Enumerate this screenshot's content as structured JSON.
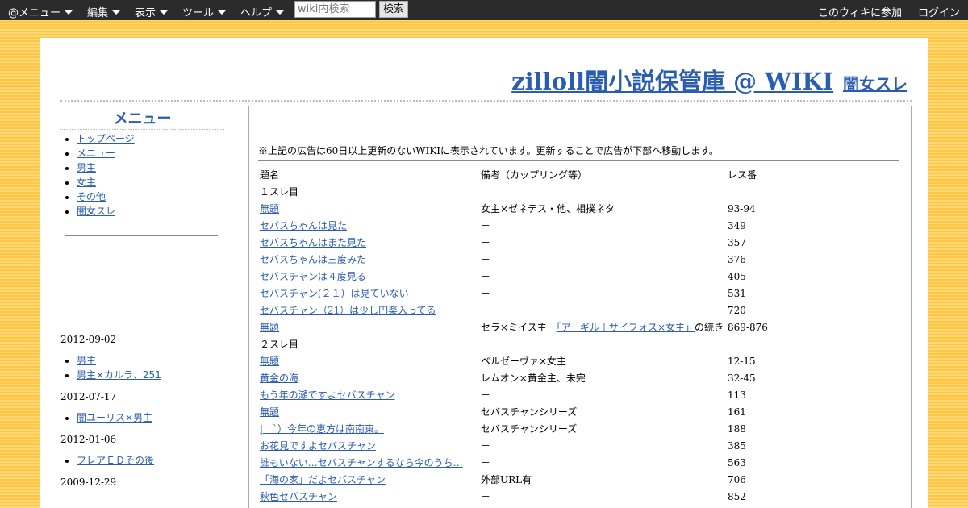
{
  "topbar": {
    "menus": [
      "@メニュー",
      "編集",
      "表示",
      "ツール",
      "ヘルプ"
    ],
    "search_placeholder": "wiki内検索",
    "search_button": "検索",
    "join_link": "このウィキに参加",
    "login_link": "ログイン"
  },
  "site": {
    "title": "zilloll闇小説保管庫 @ WIKI",
    "page_name": "闇女スレ"
  },
  "sidebar": {
    "heading": "メニュー",
    "items": [
      "トップページ",
      "メニュー",
      "男主",
      "女主",
      "その他",
      "闇女スレ"
    ]
  },
  "recent": [
    {
      "date": "2012-09-02",
      "items": [
        "男主",
        "男主×カルラ、251"
      ]
    },
    {
      "date": "2012-07-17",
      "items": [
        "闇ユーリス×男主"
      ]
    },
    {
      "date": "2012-01-06",
      "items": [
        "フレアＥＤその後"
      ]
    },
    {
      "date": "2009-12-29",
      "items": []
    }
  ],
  "main": {
    "notice": "※上記の広告は60日以上更新のないWIKIに表示されています。更新することで広告が下部へ移動します。",
    "headers": [
      "題名",
      "備考（カップリング等）",
      "レス番"
    ],
    "rows": [
      {
        "section": "１スレ目"
      },
      {
        "title": "無題",
        "note": "女主×ゼネテス・他、相撲ネタ",
        "res": "93-94"
      },
      {
        "title": "セバスちゃんは見た",
        "note": "－",
        "res": "349"
      },
      {
        "title": "セバスちゃんはまた見た",
        "note": "－",
        "res": "357"
      },
      {
        "title": "セバスちゃんは三度みた",
        "note": "－",
        "res": "376"
      },
      {
        "title": "セバスチャンは４度見る",
        "note": "－",
        "res": "405"
      },
      {
        "title": "セバスチャン(２１）は見ていない",
        "note": "－",
        "res": "531"
      },
      {
        "title": "セバスチャン（21）は少し円楽入ってる",
        "note": "－",
        "res": "720"
      },
      {
        "title": "無題",
        "note": "セラ×ミイス主　",
        "note_link": "「アーギル＋サイフォス×女主」",
        "note_tail": "の続き",
        "res": "869-876"
      },
      {
        "section": "２スレ目"
      },
      {
        "title": "無題",
        "note": "ベルゼーヴァ×女主",
        "res": "12-15"
      },
      {
        "title": "黄金の海",
        "note": "レムオン×黄金主、未完",
        "res": "32-45"
      },
      {
        "title": "もう年の瀬ですよセバスチャン",
        "note": "－",
        "res": "113"
      },
      {
        "title": "無題",
        "note": "セバスチャンシリーズ",
        "res": "161"
      },
      {
        "title": "|　`）今年の恵方は南南東。",
        "note": "セバスチャンシリーズ",
        "res": "188"
      },
      {
        "title": "お花見ですよセバスチャン",
        "note": "－",
        "res": "385"
      },
      {
        "title": "誰もいない…セバスチャンするなら今のうち…",
        "note": "－",
        "res": "563"
      },
      {
        "title": "「海の家」だよセバスチャン",
        "note": "外部URL有",
        "res": "706"
      },
      {
        "title": "秋色セバスチャン",
        "note": "－",
        "res": "852"
      }
    ]
  }
}
